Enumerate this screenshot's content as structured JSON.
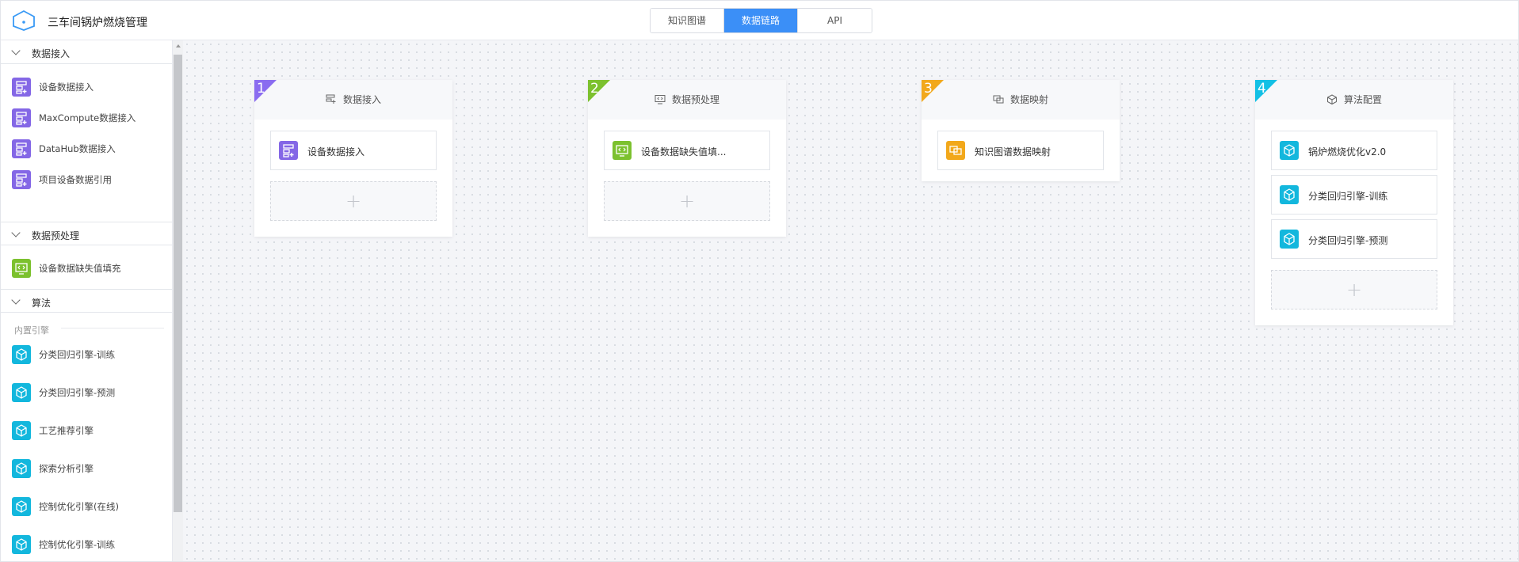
{
  "app": {
    "title": "三车间锅炉燃烧管理",
    "logo_icon": "cube-outline-icon"
  },
  "tabs": [
    {
      "label": "知识图谱",
      "active": false
    },
    {
      "label": "数据链路",
      "active": true
    },
    {
      "label": "API",
      "active": false
    }
  ],
  "sidebar": {
    "sections": [
      {
        "label": "数据接入",
        "items": [
          {
            "label": "设备数据接入",
            "icon": "data-input-icon",
            "color": "#8467e6"
          },
          {
            "label": "MaxCompute数据接入",
            "icon": "data-input-icon",
            "color": "#8467e6"
          },
          {
            "label": "DataHub数据接入",
            "icon": "data-input-icon",
            "color": "#8467e6"
          },
          {
            "label": "项目设备数据引用",
            "icon": "data-input-icon",
            "color": "#8467e6"
          }
        ]
      },
      {
        "label": "数据预处理",
        "items": [
          {
            "label": "设备数据缺失值填充",
            "icon": "preprocess-icon",
            "color": "#7cc12e"
          }
        ]
      },
      {
        "label": "算法",
        "group_label": "内置引擎",
        "items": [
          {
            "label": "分类回归引擎-训练",
            "icon": "cube-icon",
            "color": "#13b7dd"
          },
          {
            "label": "分类回归引擎-预测",
            "icon": "cube-icon",
            "color": "#13b7dd"
          },
          {
            "label": "工艺推荐引擎",
            "icon": "cube-icon",
            "color": "#13b7dd"
          },
          {
            "label": "探索分析引擎",
            "icon": "cube-icon",
            "color": "#13b7dd"
          },
          {
            "label": "控制优化引擎(在线)",
            "icon": "cube-icon",
            "color": "#13b7dd"
          },
          {
            "label": "控制优化引擎-训练",
            "icon": "cube-icon",
            "color": "#13b7dd"
          }
        ]
      }
    ]
  },
  "stages": [
    {
      "number": "1",
      "title": "数据接入",
      "title_icon": "data-input-outline-icon",
      "corner_color": "#8a6cf0",
      "nodes": [
        {
          "label": "设备数据接入",
          "icon": "data-input-icon",
          "color": "#8467e6"
        }
      ],
      "add_slot": true
    },
    {
      "number": "2",
      "title": "数据预处理",
      "title_icon": "code-monitor-outline-icon",
      "corner_color": "#7cc12e",
      "nodes": [
        {
          "label": "设备数据缺失值填...",
          "icon": "preprocess-icon",
          "color": "#7cc12e"
        }
      ],
      "add_slot": true
    },
    {
      "number": "3",
      "title": "数据映射",
      "title_icon": "mapping-outline-icon",
      "corner_color": "#f2a81b",
      "nodes": [
        {
          "label": "知识图谱数据映射",
          "icon": "mapping-icon",
          "color": "#f2a81b"
        }
      ],
      "add_slot": false
    },
    {
      "number": "4",
      "title": "算法配置",
      "title_icon": "cube-outline-icon",
      "corner_color": "#13c0e5",
      "nodes": [
        {
          "label": "锅炉燃烧优化v2.0",
          "icon": "cube-icon",
          "color": "#13b7dd"
        },
        {
          "label": "分类回归引擎-训练",
          "icon": "cube-icon",
          "color": "#13b7dd"
        },
        {
          "label": "分类回归引擎-预测",
          "icon": "cube-icon",
          "color": "#13b7dd"
        }
      ],
      "add_slot": true
    }
  ],
  "add_symbol": "+"
}
